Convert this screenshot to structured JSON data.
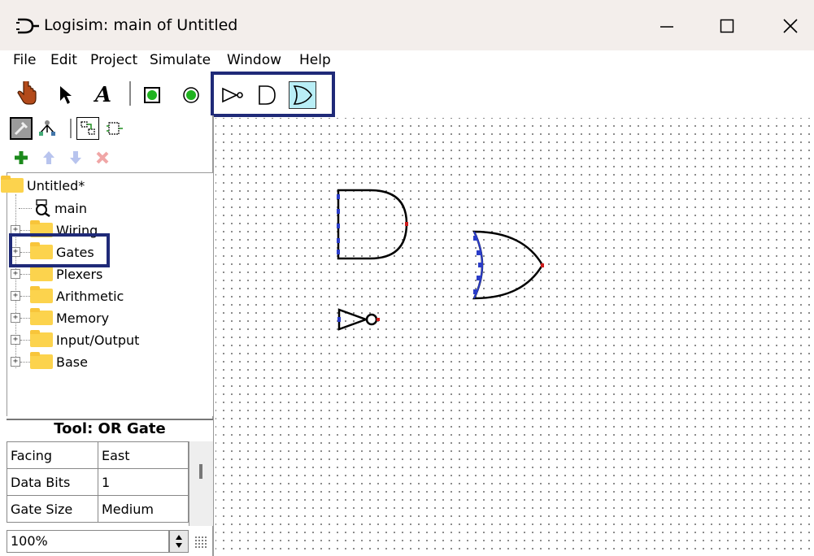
{
  "window": {
    "title": "Logisim: main of Untitled",
    "controls": [
      "minimize-icon",
      "maximize-icon",
      "close-icon"
    ]
  },
  "menu": [
    "File",
    "Edit",
    "Project",
    "Simulate",
    "Window",
    "Help"
  ],
  "toolbar": {
    "tools": [
      "poke-hand-icon",
      "select-arrow-icon",
      "text-tool-icon",
      "input-pin-icon",
      "output-pin-icon"
    ],
    "gate_tools": [
      "not-gate-icon",
      "and-gate-icon",
      "or-gate-icon"
    ],
    "selected_gate_tool": "or-gate-icon"
  },
  "explorer": {
    "view_tools": [
      "toolbox-view-icon",
      "simulation-tree-icon",
      "layout-view-icon",
      "appearance-view-icon"
    ],
    "project_buttons": [
      "add-circuit-icon",
      "move-up-icon",
      "move-down-icon",
      "delete-icon"
    ],
    "tree": {
      "root": "Untitled*",
      "circuit": "main",
      "libraries": [
        "Wiring",
        "Gates",
        "Plexers",
        "Arithmetic",
        "Memory",
        "Input/Output",
        "Base"
      ]
    }
  },
  "attributes": {
    "title": "Tool: OR Gate",
    "rows": [
      {
        "key": "Facing",
        "value": "East"
      },
      {
        "key": "Data Bits",
        "value": "1"
      },
      {
        "key": "Gate Size",
        "value": "Medium"
      }
    ]
  },
  "zoom": "100%",
  "canvas": {
    "components": [
      "AND Gate",
      "OR Gate",
      "NOT Gate"
    ]
  },
  "colors": {
    "highlight_border": "#1f2a78",
    "selected_tool_bg": "#b9eef6",
    "port_input": "#2a3cc8",
    "port_output": "#cc1b1b",
    "folder": "#fcd34d"
  }
}
